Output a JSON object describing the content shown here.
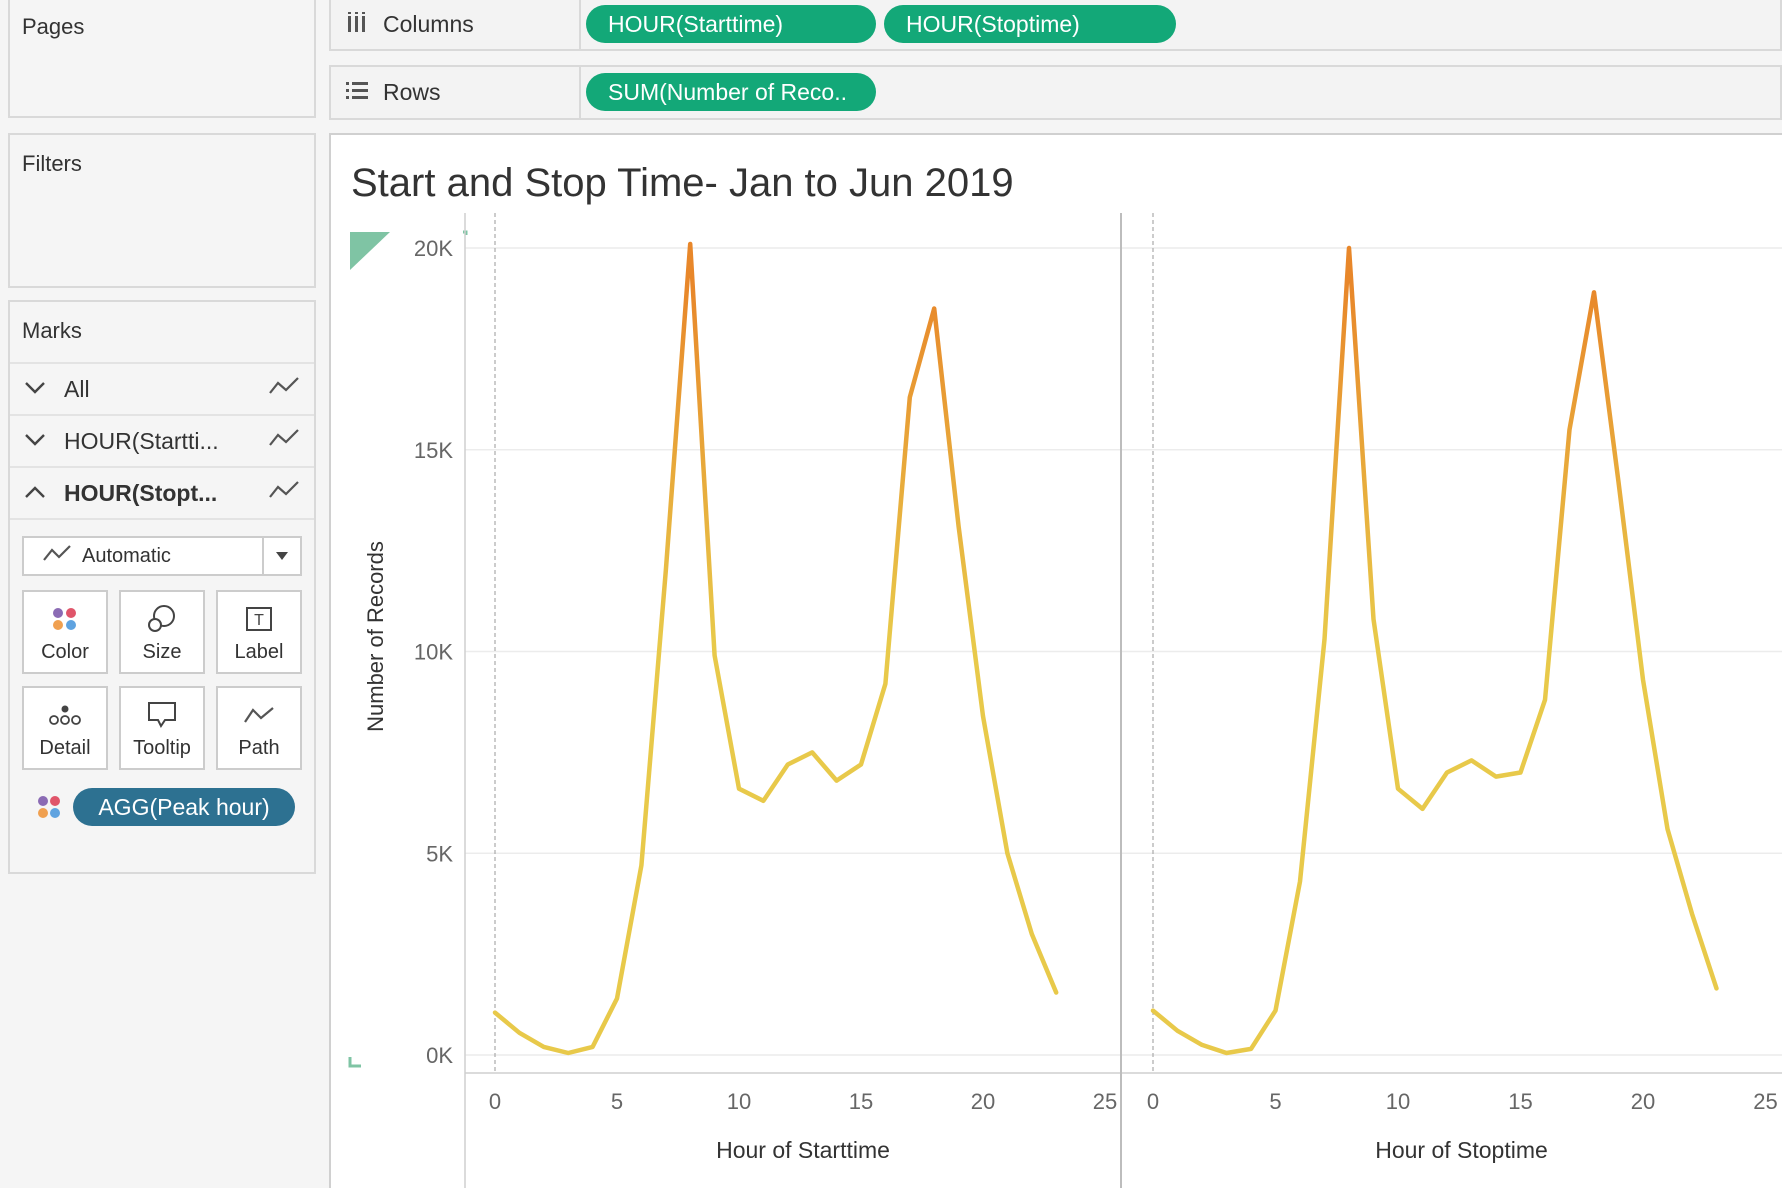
{
  "panels": {
    "pages": "Pages",
    "filters": "Filters",
    "marks": "Marks"
  },
  "shelves": {
    "columns": {
      "label": "Columns",
      "icon": "columns-icon",
      "pills": [
        "HOUR(Starttime)",
        "HOUR(Stoptime)"
      ]
    },
    "rows": {
      "label": "Rows",
      "icon": "rows-icon",
      "pills": [
        "SUM(Number of Reco.."
      ]
    }
  },
  "marks": {
    "rows": [
      {
        "label": "All",
        "state": "collapsed"
      },
      {
        "label": "HOUR(Startti...",
        "state": "collapsed"
      },
      {
        "label": "HOUR(Stopt...",
        "state": "expanded"
      }
    ],
    "mark_type": "Automatic",
    "cards": [
      "Color",
      "Size",
      "Label",
      "Detail",
      "Tooltip",
      "Path"
    ],
    "color_pill": "AGG(Peak hour)"
  },
  "viz": {
    "title": "Start and Stop Time- Jan to Jun 2019"
  },
  "colors": {
    "pill_green": "#13a878",
    "pill_blue": "#2d7191",
    "line_low": "#e8c94a",
    "line_high": "#e8872a"
  },
  "chart_data": {
    "type": "line",
    "ylabel": "Number of Records",
    "ylim": [
      0,
      20000
    ],
    "yticks": [
      "0K",
      "5K",
      "10K",
      "15K",
      "20K"
    ],
    "panes": [
      {
        "xlabel": "Hour of Starttime",
        "xticks": [
          "0",
          "5",
          "10",
          "15",
          "20",
          "25"
        ],
        "x": [
          0,
          1,
          2,
          3,
          4,
          5,
          6,
          7,
          8,
          9,
          10,
          11,
          12,
          13,
          14,
          15,
          16,
          17,
          18,
          19,
          20,
          21,
          22,
          23
        ],
        "y": [
          1050,
          550,
          200,
          50,
          200,
          1400,
          4700,
          12000,
          20100,
          9900,
          6600,
          6300,
          7200,
          7500,
          6800,
          7200,
          9200,
          16300,
          18500,
          13100,
          8400,
          5000,
          3000,
          1550
        ]
      },
      {
        "xlabel": "Hour of Stoptime",
        "xticks": [
          "0",
          "5",
          "10",
          "15",
          "20",
          "25"
        ],
        "x": [
          0,
          1,
          2,
          3,
          4,
          5,
          6,
          7,
          8,
          9,
          10,
          11,
          12,
          13,
          14,
          15,
          16,
          17,
          18,
          19,
          20,
          21,
          22,
          23
        ],
        "y": [
          1100,
          600,
          250,
          50,
          150,
          1100,
          4300,
          10300,
          20000,
          10800,
          6600,
          6100,
          7000,
          7300,
          6900,
          7000,
          8800,
          15500,
          18900,
          14200,
          9300,
          5600,
          3500,
          1650
        ]
      }
    ]
  }
}
